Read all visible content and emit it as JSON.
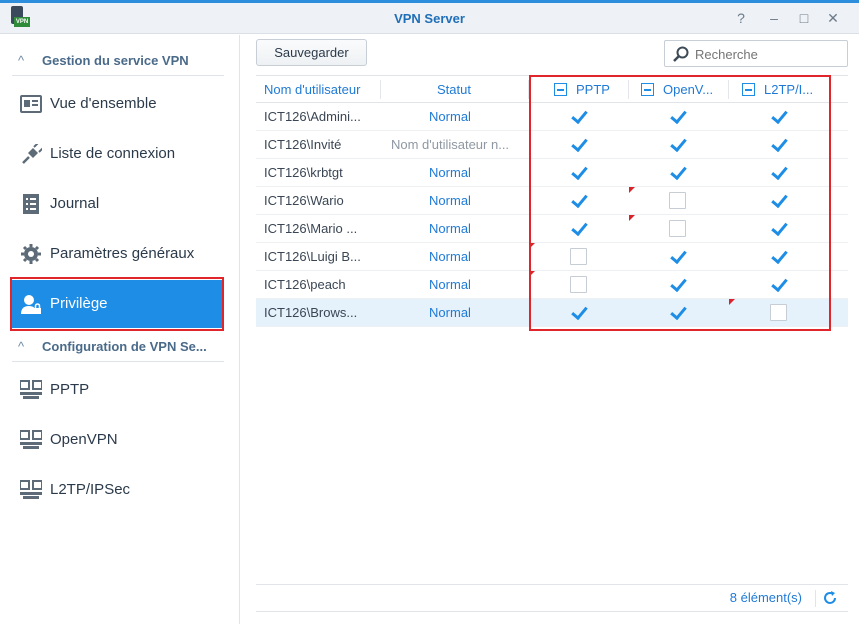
{
  "window": {
    "title": "VPN Server",
    "app_icon_badge": "VPN"
  },
  "controls": {
    "help": "?",
    "minimize": "–",
    "maximize": "□",
    "close": "✕"
  },
  "sidebar": {
    "section1": "Gestion du service VPN",
    "section2": "Configuration de VPN Se...",
    "items": [
      {
        "label": "Vue d'ensemble",
        "icon": "overview-icon"
      },
      {
        "label": "Liste de connexion",
        "icon": "plug-icon"
      },
      {
        "label": "Journal",
        "icon": "log-icon"
      },
      {
        "label": "Paramètres généraux",
        "icon": "gear-icon"
      },
      {
        "label": "Privilège",
        "icon": "user-lock-icon",
        "active": true
      },
      {
        "label": "PPTP",
        "icon": "network-icon"
      },
      {
        "label": "OpenVPN",
        "icon": "network-icon"
      },
      {
        "label": "L2TP/IPSec",
        "icon": "network-icon"
      }
    ]
  },
  "toolbar": {
    "save_label": "Sauvegarder",
    "search_placeholder": "Recherche"
  },
  "table": {
    "columns": [
      "Nom d'utilisateur",
      "Statut",
      "PPTP",
      "OpenV...",
      "L2TP/I..."
    ],
    "rows": [
      {
        "user": "ICT126\\Admini...",
        "status": "Normal",
        "pptp": true,
        "openvpn": true,
        "l2tp": true
      },
      {
        "user": "ICT126\\Invité",
        "status": "Nom d'utilisateur n...",
        "pptp": true,
        "openvpn": true,
        "l2tp": true
      },
      {
        "user": "ICT126\\krbtgt",
        "status": "Normal",
        "pptp": true,
        "openvpn": true,
        "l2tp": true
      },
      {
        "user": "ICT126\\Wario",
        "status": "Normal",
        "pptp": true,
        "openvpn": false,
        "l2tp": true
      },
      {
        "user": "ICT126\\Mario ...",
        "status": "Normal",
        "pptp": true,
        "openvpn": false,
        "l2tp": true
      },
      {
        "user": "ICT126\\Luigi B...",
        "status": "Normal",
        "pptp": false,
        "openvpn": true,
        "l2tp": true
      },
      {
        "user": "ICT126\\peach",
        "status": "Normal",
        "pptp": false,
        "openvpn": true,
        "l2tp": true
      },
      {
        "user": "ICT126\\Brows...",
        "status": "Normal",
        "pptp": true,
        "openvpn": true,
        "l2tp": false
      }
    ]
  },
  "footer": {
    "count": "8 élément(s)"
  },
  "colors": {
    "accent": "#1e8de6",
    "highlight": "#e0252b",
    "title": "#1f6fb8"
  }
}
